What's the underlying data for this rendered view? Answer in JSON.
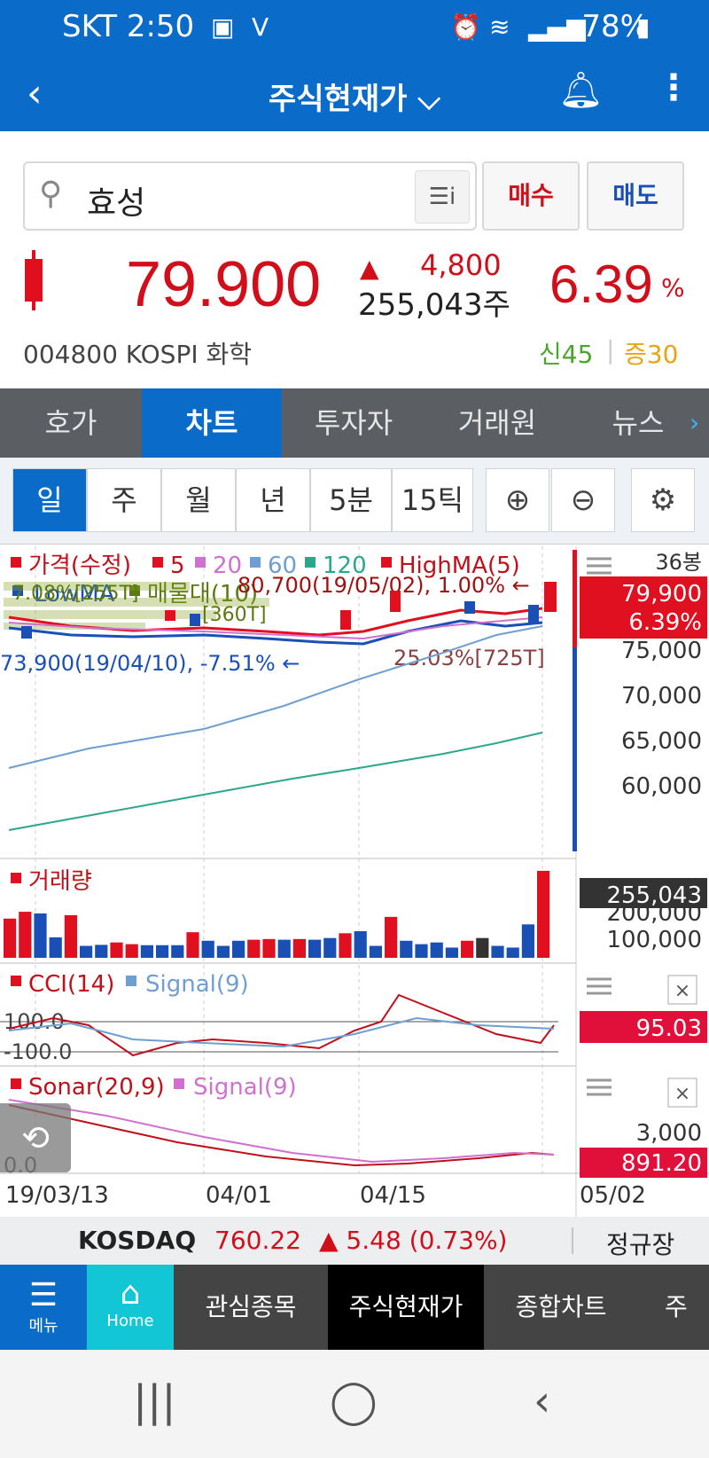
{
  "status_bar": {
    "carrier_time": "SKT 2:50",
    "battery": "78%"
  },
  "appbar": {
    "title": "주식현재가 ⌵"
  },
  "search": {
    "query": "효성"
  },
  "buttons": {
    "buy": "매수",
    "sell": "매도"
  },
  "quote": {
    "price": "79.900",
    "change": "4,800",
    "volume": "255,043주",
    "percent": "6.39",
    "percent_sign": "%",
    "code": "004800",
    "market": "KOSPI",
    "sector": "화학",
    "badge_new": "신45",
    "badge_margin": "증30"
  },
  "tabs": [
    "호가",
    "차트",
    "투자자",
    "거래원",
    "뉴스"
  ],
  "periods": [
    "일",
    "주",
    "월",
    "년",
    "5분",
    "15틱"
  ],
  "chart": {
    "legend_price": [
      "가격(수정)",
      "5",
      "20",
      "60",
      "120",
      "HighMA(5)"
    ],
    "legend_price2": [
      "LowMA",
      "매물대(10)"
    ],
    "count": "36봉",
    "price_badge": [
      "79,900",
      "6.39%"
    ],
    "y_ticks": [
      "75,000",
      "70,000",
      "65,000",
      "60,000"
    ],
    "high_ann": "80,700(19/05/02), 1.00% ←",
    "low_ann": "73,900(19/04/10), -7.51% ←",
    "vp_ann": [
      "7.08%[255T]",
      "25.03%[725T]",
      "[360T]"
    ],
    "volume_label": "거래량",
    "volume_badge": "255,043",
    "vol_ticks": [
      "200,000",
      "100,000"
    ],
    "cci_legend": [
      "CCI(14)",
      "Signal(9)"
    ],
    "cci_levels": [
      "100.0",
      "-100.0"
    ],
    "cci_badge": "95.03",
    "sonar_legend": [
      "Sonar(20,9)",
      "Signal(9)"
    ],
    "sonar_tick": "3,000",
    "sonar_badge": "891.20",
    "sonar_zero": "0.0",
    "x_dates": [
      "19/03/13",
      "04/01",
      "04/15",
      "05/02"
    ]
  },
  "chart_data": {
    "type": "bar",
    "categories": [
      "19/03/13",
      "04/01",
      "04/15",
      "05/02"
    ],
    "series": [
      {
        "name": "거래량",
        "values": [
          115,
          135,
          130,
          60,
          125,
          35,
          38,
          45,
          40,
          37,
          37,
          37,
          75,
          50,
          35,
          50,
          53,
          55,
          53,
          55,
          53,
          58,
          72,
          78,
          35,
          120,
          50,
          40,
          45,
          30,
          50,
          58,
          35,
          30,
          98,
          255
        ]
      }
    ],
    "ylim": [
      0,
      260
    ],
    "colors": {
      "up": "#e01020",
      "down": "#1a4fb5",
      "flat": "#333333"
    }
  },
  "kosdaq": {
    "name": "KOSDAQ",
    "value": "760.22",
    "delta": "▲ 5.48 (0.73%)",
    "session": "정규장"
  },
  "bottom_nav": {
    "menu": "메뉴",
    "home": "Home",
    "items": [
      "관심종목",
      "주식현재가",
      "종합차트",
      "주식"
    ]
  }
}
